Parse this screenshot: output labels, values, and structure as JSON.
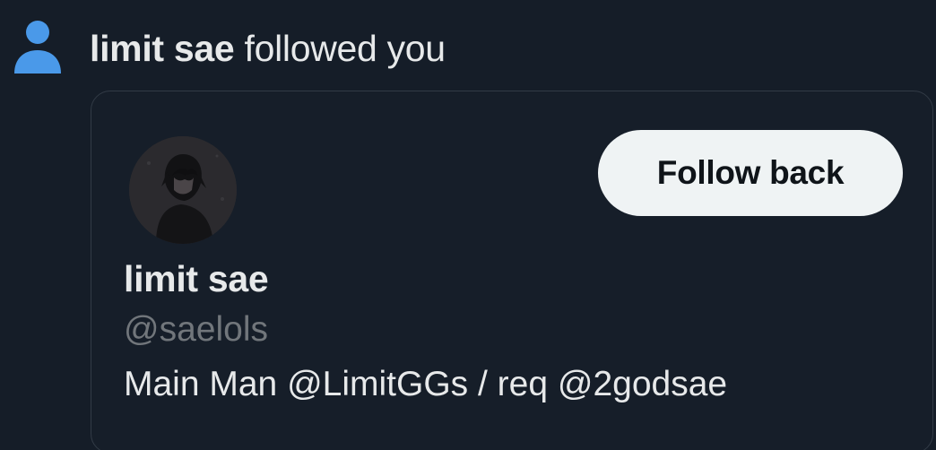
{
  "notification": {
    "icon": "person-icon",
    "actor": "limit sae",
    "action": " followed you",
    "icon_color": "#4a99e9"
  },
  "card": {
    "avatar": "avatar",
    "follow_button_label": "Follow back",
    "display_name": "limit sae",
    "handle": "@saelols",
    "bio": "Main Man @LimitGGs / req @2godsae"
  },
  "colors": {
    "background": "#151d28",
    "card_border": "#323b46",
    "primary_text": "#e7e9ea",
    "secondary_text": "#71767b",
    "button_bg": "#eff3f4",
    "button_text": "#0f1419"
  }
}
